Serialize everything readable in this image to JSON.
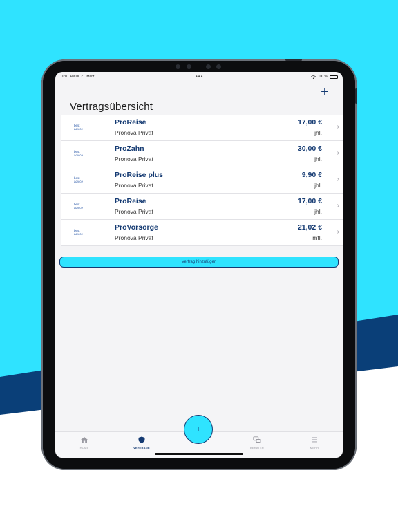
{
  "status": {
    "time_date": "10:01 AM   Di. 21. März",
    "dots": "•••",
    "battery": "100 %"
  },
  "header": {
    "title": "Vertragsübersicht",
    "add_icon": "+"
  },
  "contracts": [
    {
      "logo": "best advice",
      "name": "ProReise",
      "provider": "Pronova Privat",
      "price": "17,00 €",
      "period": "jhl."
    },
    {
      "logo": "best advice",
      "name": "ProZahn",
      "provider": "Pronova Privat",
      "price": "30,00 €",
      "period": "jhl."
    },
    {
      "logo": "best advice",
      "name": "ProReise plus",
      "provider": "Pronova Privat",
      "price": "9,90 €",
      "period": "jhl."
    },
    {
      "logo": "best advice",
      "name": "ProReise",
      "provider": "Pronova Privat",
      "price": "17,00 €",
      "period": "jhl."
    },
    {
      "logo": "best advice",
      "name": "ProVorsorge",
      "provider": "Pronova Privat",
      "price": "21,02 €",
      "period": "mtl."
    }
  ],
  "add_contract_label": "Vertrag hinzufügen",
  "tabs": [
    {
      "label": "HOME",
      "icon": "home-icon"
    },
    {
      "label": "VERTRÄGE",
      "icon": "shield-icon"
    },
    {
      "label": "BERATER",
      "icon": "chat-icon"
    },
    {
      "label": "MEHR",
      "icon": "menu-icon"
    }
  ],
  "fab_label": "+",
  "colors": {
    "background": "#2fe3ff",
    "band": "#0a3f78",
    "accent": "#143a72"
  }
}
